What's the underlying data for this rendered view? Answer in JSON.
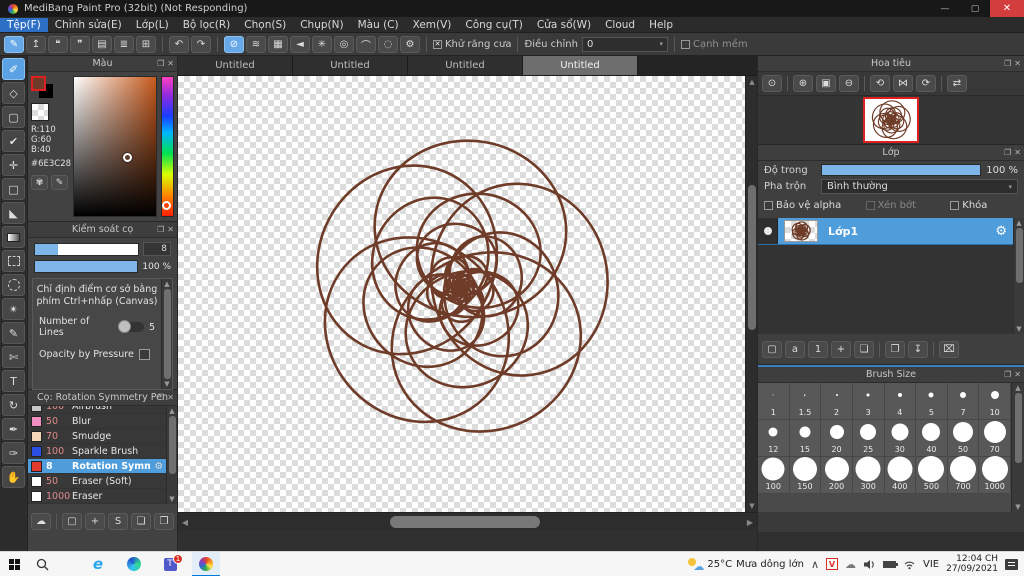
{
  "titlebar": {
    "title": "MediBang Paint Pro (32bit) (Not Responding)",
    "window_controls": [
      {
        "name": "minimize-button",
        "glyph": "—"
      },
      {
        "name": "maximize-button",
        "glyph": "▢"
      },
      {
        "name": "close-button",
        "glyph": "✕"
      }
    ]
  },
  "menubar": {
    "items": [
      "Tệp(F)",
      "Chỉnh sửa(E)",
      "Lớp(L)",
      "Bộ lọc(R)",
      "Chọn(S)",
      "Chụp(N)",
      "Màu (C)",
      "Xem(V)",
      "Công cụ(T)",
      "Cửa sổ(W)",
      "Cloud",
      "Help"
    ],
    "active_index": 0
  },
  "toolbar": {
    "groups": [
      [
        {
          "name": "save-icon",
          "glyph": "✎",
          "active": true
        },
        {
          "name": "export-icon",
          "glyph": "↥"
        },
        {
          "name": "comment-icon",
          "glyph": "❝"
        },
        {
          "name": "comment-panel-icon",
          "glyph": "❞"
        },
        {
          "name": "document-icon",
          "glyph": "▤"
        },
        {
          "name": "list-icon",
          "glyph": "≣"
        },
        {
          "name": "table-icon",
          "glyph": "⊞"
        }
      ],
      [
        {
          "name": "undo-icon",
          "glyph": "↶"
        },
        {
          "name": "redo-icon",
          "glyph": "↷"
        }
      ],
      [
        {
          "name": "snap-off-icon",
          "glyph": "⊘",
          "active": true
        },
        {
          "name": "snap-parallel-icon",
          "glyph": "≋"
        },
        {
          "name": "snap-grid-icon",
          "glyph": "▦"
        },
        {
          "name": "snap-vanishing-icon",
          "glyph": "◄"
        },
        {
          "name": "snap-radial-icon",
          "glyph": "✳"
        },
        {
          "name": "snap-concentric-icon",
          "glyph": "◎"
        },
        {
          "name": "snap-curve-icon",
          "glyph": "⌒"
        },
        {
          "name": "snap-ring-icon",
          "glyph": "◌"
        },
        {
          "name": "snap-settings-icon",
          "glyph": "⚙"
        }
      ]
    ],
    "antialias_label": "Khử răng cưa",
    "correction_label": "Điều chỉnh",
    "correction_value": "0",
    "soft_edge_label": "Cạnh mềm"
  },
  "toolstrip": {
    "tools": [
      {
        "name": "brush-tool",
        "glyph": "✐",
        "active": true
      },
      {
        "name": "eraser-tool",
        "glyph": "◇"
      },
      {
        "name": "shape-brush-tool",
        "glyph": "▢"
      },
      {
        "name": "control-point-tool",
        "glyph": "✔"
      },
      {
        "name": "move-tool",
        "glyph": "✛"
      },
      {
        "name": "select-tool",
        "glyph": "□"
      },
      {
        "name": "fill-tool",
        "glyph": "◣"
      },
      {
        "name": "gradient-tool",
        "glyph": "",
        "css": "grad"
      },
      {
        "name": "lasso-select-tool",
        "glyph": "",
        "css": "dash-square"
      },
      {
        "name": "auto-select-tool",
        "glyph": "",
        "css": "dash-circle"
      },
      {
        "name": "magic-wand-tool",
        "glyph": "✴"
      },
      {
        "name": "select-pen-tool",
        "glyph": "✎"
      },
      {
        "name": "select-eraser-tool",
        "glyph": "✄"
      },
      {
        "name": "text-tool",
        "glyph": "T"
      },
      {
        "name": "rotate-view-tool",
        "glyph": "↻"
      },
      {
        "name": "pen-tool",
        "glyph": "✒"
      },
      {
        "name": "eyedropper-tool",
        "glyph": "✑"
      },
      {
        "name": "hand-tool",
        "glyph": "✋"
      }
    ]
  },
  "panel_icons": [
    {
      "name": "popout-icon",
      "glyph": "❐"
    },
    {
      "name": "close-icon",
      "glyph": "✕"
    }
  ],
  "color_panel": {
    "title": "Màu",
    "r": "R:110",
    "g": "G:60",
    "b": "B:40",
    "hex": "#6E3C28",
    "fg_color": "#6E3C28",
    "buttons": [
      {
        "name": "palette-icon",
        "glyph": "✾"
      },
      {
        "name": "palette-edit-icon",
        "glyph": "✎"
      }
    ]
  },
  "brush_control_panel": {
    "title": "Kiểm soát cọ",
    "size_value": "8",
    "size_fill_pct": 22,
    "opacity_value": "100 %",
    "opacity_fill_pct": 100,
    "hint_line1": "Chỉ định điểm cơ sở bằng",
    "hint_line2": "phím Ctrl+nhấp (Canvas)",
    "lines_label": "Number of Lines",
    "lines_value": "5",
    "pressure_label": "Opacity by Pressure"
  },
  "brush_panel": {
    "title": "Cọ: Rotation Symmetry Pen",
    "brushes": [
      {
        "size": "100",
        "name": "Airbrush",
        "swatch": "#c8c8c8",
        "partial": true
      },
      {
        "size": "50",
        "name": "Blur",
        "swatch": "#ef8fc0"
      },
      {
        "size": "70",
        "name": "Smudge",
        "swatch": "#f6d8b8"
      },
      {
        "size": "100",
        "name": "Sparkle Brush",
        "swatch": "#2b4fe0"
      },
      {
        "size": "8",
        "name": "Rotation Symmetry",
        "swatch": "#e23b2e",
        "selected": true
      },
      {
        "size": "50",
        "name": "Eraser (Soft)",
        "swatch": "#ffffff"
      },
      {
        "size": "1000",
        "name": "Eraser",
        "swatch": "#ffffff"
      }
    ],
    "settings_glyph": "⚙",
    "buttons": [
      {
        "name": "cloud-upload-icon",
        "glyph": "☁"
      },
      {
        "name": "new-brush-icon",
        "glyph": "▢"
      },
      {
        "name": "add-brush-menu-icon",
        "glyph": "+"
      },
      {
        "name": "script-brush-icon",
        "glyph": "S"
      },
      {
        "name": "brush-folder-icon",
        "glyph": "❏"
      },
      {
        "name": "duplicate-brush-icon",
        "glyph": "❐"
      }
    ]
  },
  "canvas": {
    "tabs": [
      "Untitled",
      "Untitled",
      "Untitled",
      "Untitled"
    ],
    "active_tab": 3,
    "stroke_color": "#6E3C28"
  },
  "navigator_panel": {
    "title": "Hoa tiêu",
    "buttons": [
      {
        "name": "zoom-actual-icon",
        "glyph": "⊙"
      },
      {
        "name": "zoom-in-icon",
        "glyph": "⊕"
      },
      {
        "name": "fit-screen-icon",
        "glyph": "▣"
      },
      {
        "name": "zoom-out-icon",
        "glyph": "⊖"
      },
      {
        "name": "rotate-ccw-icon",
        "glyph": "⟲"
      },
      {
        "name": "reset-view-icon",
        "glyph": "⋈"
      },
      {
        "name": "rotate-cw-icon",
        "glyph": "⟳"
      },
      {
        "name": "flip-icon",
        "glyph": "⇄"
      }
    ]
  },
  "layer_panel": {
    "title": "Lớp",
    "opacity_label": "Độ trong",
    "opacity_value": "100 %",
    "blend_label": "Pha trộn",
    "blend_value": "Bình thường",
    "check_alpha": "Bảo vệ alpha",
    "check_clip": "Xén bớt",
    "check_lock": "Khóa",
    "layer_name": "Lớp1",
    "gear_glyph": "⚙",
    "buttons": [
      {
        "name": "new-layer-icon",
        "glyph": "▢"
      },
      {
        "name": "new-8bit-layer-icon",
        "glyph": "a"
      },
      {
        "name": "new-1bit-layer-icon",
        "glyph": "1"
      },
      {
        "name": "add-layer-menu-icon",
        "glyph": "+"
      },
      {
        "name": "layer-folder-icon",
        "glyph": "❏"
      },
      {
        "name": "duplicate-layer-icon",
        "glyph": "❐"
      },
      {
        "name": "merge-layer-icon",
        "glyph": "↧"
      },
      {
        "name": "delete-layer-icon",
        "glyph": "⌧"
      }
    ]
  },
  "brush_size_panel": {
    "title": "Brush Size",
    "sizes": [
      "1",
      "1.5",
      "2",
      "3",
      "4",
      "5",
      "7",
      "10",
      "12",
      "15",
      "20",
      "25",
      "30",
      "40",
      "50",
      "70",
      "100",
      "150",
      "200",
      "300",
      "400",
      "500",
      "700",
      "1000"
    ]
  },
  "taskbar": {
    "temp": "25°C",
    "weather": "Mưa dông lớn",
    "chevron": "∧",
    "lang": "VIE",
    "time": "12:04 CH",
    "date": "27/09/2021",
    "teams_badge": "1",
    "unikey_letter": "V"
  },
  "colors": {
    "accent_blue": "#5aa2e4",
    "selection_blue": "#4f9ddb",
    "slider_blue": "#7db5e8",
    "stroke_brown": "#6E3C28",
    "close_red": "#d33d3d"
  }
}
